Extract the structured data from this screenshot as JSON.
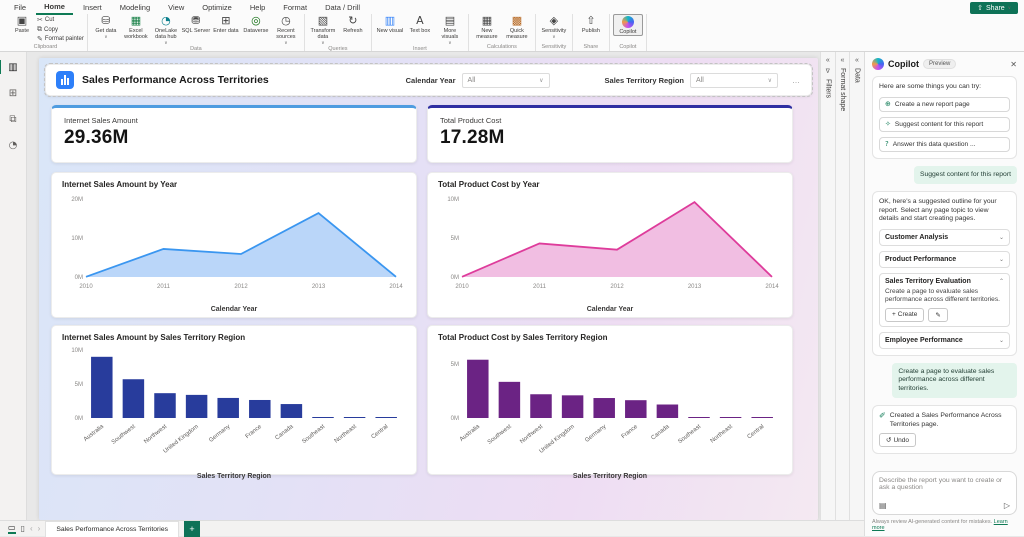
{
  "app": {
    "menu_tabs": [
      "File",
      "Home",
      "Insert",
      "Modeling",
      "View",
      "Optimize",
      "Help",
      "Format",
      "Data / Drill"
    ],
    "active_tab": "Home",
    "share_label": "Share",
    "ribbon_groups": [
      {
        "label": "Clipboard",
        "blocks": [
          {
            "big": {
              "label": "Paste",
              "icon": "paste-icon",
              "glyph": "▣"
            }
          },
          {
            "stack": [
              {
                "label": "Cut",
                "icon": "cut-icon",
                "glyph": "✂"
              },
              {
                "label": "Copy",
                "icon": "copy-icon",
                "glyph": "⧉"
              },
              {
                "label": "Format painter",
                "icon": "format-painter-icon",
                "glyph": "✎"
              }
            ]
          }
        ]
      },
      {
        "label": "Data",
        "blocks": [
          {
            "big": {
              "label": "Get data",
              "icon": "get-data-icon",
              "glyph": "⛁",
              "caret": true
            }
          },
          {
            "big": {
              "label": "Excel workbook",
              "icon": "excel-workbook-icon",
              "glyph": "▦",
              "color": "#107c41"
            }
          },
          {
            "big": {
              "label": "OneLake data hub",
              "icon": "onelake-data-hub-icon",
              "glyph": "◔",
              "caret": true,
              "color": "#0a7f8c"
            }
          },
          {
            "big": {
              "label": "SQL Server",
              "icon": "sql-server-icon",
              "glyph": "⛃"
            }
          },
          {
            "big": {
              "label": "Enter data",
              "icon": "enter-data-icon",
              "glyph": "⊞"
            }
          },
          {
            "big": {
              "label": "Dataverse",
              "icon": "dataverse-icon",
              "glyph": "◎",
              "color": "#0b6a0b"
            }
          },
          {
            "big": {
              "label": "Recent sources",
              "icon": "recent-sources-icon",
              "glyph": "◷",
              "caret": true
            }
          }
        ]
      },
      {
        "label": "Queries",
        "blocks": [
          {
            "big": {
              "label": "Transform data",
              "icon": "transform-data-icon",
              "glyph": "▧",
              "caret": true
            }
          },
          {
            "big": {
              "label": "Refresh",
              "icon": "refresh-icon",
              "glyph": "↻"
            }
          }
        ]
      },
      {
        "label": "Insert",
        "blocks": [
          {
            "big": {
              "label": "New visual",
              "icon": "new-visual-icon",
              "glyph": "▥",
              "color": "#2d7ff9"
            }
          },
          {
            "big": {
              "label": "Text box",
              "icon": "text-box-icon",
              "glyph": "A"
            }
          },
          {
            "big": {
              "label": "More visuals",
              "icon": "more-visuals-icon",
              "glyph": "▤",
              "caret": true
            }
          }
        ]
      },
      {
        "label": "Calculations",
        "blocks": [
          {
            "big": {
              "label": "New measure",
              "icon": "new-measure-icon",
              "glyph": "▦"
            }
          },
          {
            "big": {
              "label": "Quick measure",
              "icon": "quick-measure-icon",
              "glyph": "▩",
              "color": "#b5651d"
            }
          }
        ]
      },
      {
        "label": "Sensitivity",
        "blocks": [
          {
            "big": {
              "label": "Sensitivity",
              "icon": "sensitivity-icon",
              "glyph": "◈",
              "caret": true
            }
          }
        ]
      },
      {
        "label": "Share",
        "blocks": [
          {
            "big": {
              "label": "Publish",
              "icon": "publish-icon",
              "glyph": "⇧"
            }
          }
        ]
      },
      {
        "label": "Copilot",
        "blocks": [
          {
            "big": {
              "label": "Copilot",
              "icon": "copilot-icon",
              "glyph": "",
              "selected": true,
              "orb": true
            }
          }
        ]
      }
    ]
  },
  "left_rail": [
    {
      "icon": "report-view-icon",
      "glyph": "▥",
      "active": true
    },
    {
      "icon": "table-view-icon",
      "glyph": "⊞",
      "active": false
    },
    {
      "icon": "model-view-icon",
      "glyph": "⧉",
      "active": false
    },
    {
      "icon": "dax-query-view-icon",
      "glyph": "◔",
      "active": false
    }
  ],
  "report": {
    "title": "Sales Performance Across Territories",
    "more_options": "…",
    "slicers": [
      {
        "label": "Calendar Year",
        "value": "All"
      },
      {
        "label": "Sales Territory Region",
        "value": "All"
      }
    ],
    "cards": [
      {
        "title": "Internet Sales Amount",
        "value": "29.36M",
        "accent": "#4e9ce0"
      },
      {
        "title": "Total Product Cost",
        "value": "17.28M",
        "accent": "#2f2fa2"
      }
    ]
  },
  "chart_data": [
    {
      "type": "area",
      "title": "Internet Sales Amount by Year",
      "xlabel": "Calendar Year",
      "x": [
        "2010",
        "2011",
        "2012",
        "2013",
        "2014"
      ],
      "values": [
        0.05,
        7.2,
        5.9,
        16.4,
        0.04
      ],
      "ymax": 20,
      "yticks": [
        {
          "v": 0,
          "label": "0M"
        },
        {
          "v": 10,
          "label": "10M"
        },
        {
          "v": 20,
          "label": "20M"
        }
      ],
      "line": "#3a96f0",
      "fill": "#aecff8"
    },
    {
      "type": "area",
      "title": "Total Product Cost by Year",
      "xlabel": "Calendar Year",
      "x": [
        "2010",
        "2011",
        "2012",
        "2013",
        "2014"
      ],
      "values": [
        0.03,
        4.3,
        3.5,
        9.6,
        0.02
      ],
      "ymax": 10,
      "yticks": [
        {
          "v": 0,
          "label": "0M"
        },
        {
          "v": 5,
          "label": "5M"
        },
        {
          "v": 10,
          "label": "10M"
        }
      ],
      "line": "#de3c9b",
      "fill": "#efb3dd"
    },
    {
      "type": "bar",
      "title": "Internet Sales Amount by Sales Territory Region",
      "xlabel": "Sales Territory Region",
      "categories": [
        "Australia",
        "Southwest",
        "Northwest",
        "United Kingdom",
        "Germany",
        "France",
        "Canada",
        "Southeast",
        "Northeast",
        "Central"
      ],
      "values": [
        9.0,
        5.7,
        3.65,
        3.4,
        2.95,
        2.65,
        2.05,
        0.1,
        0.1,
        0.08
      ],
      "ymax": 10,
      "yticks": [
        {
          "v": 0,
          "label": "0M"
        },
        {
          "v": 5,
          "label": "5M"
        },
        {
          "v": 10,
          "label": "10M"
        }
      ],
      "bar": "#283c9c"
    },
    {
      "type": "bar",
      "title": "Total Product Cost by Sales Territory Region",
      "xlabel": "Sales Territory Region",
      "categories": [
        "Australia",
        "Southwest",
        "Northwest",
        "United Kingdom",
        "Germany",
        "France",
        "Canada",
        "Southeast",
        "Northeast",
        "Central"
      ],
      "values": [
        5.4,
        3.35,
        2.2,
        2.1,
        1.85,
        1.65,
        1.25,
        0.06,
        0.06,
        0.05
      ],
      "ymax": 6.3,
      "yticks": [
        {
          "v": 0,
          "label": "0M"
        },
        {
          "v": 5,
          "label": "5M"
        }
      ],
      "bar": "#6b2384"
    }
  ],
  "side_panels": [
    {
      "label": "Filters",
      "collapse_glyph": "«",
      "icon": "filter-icon",
      "glyph": "∇"
    },
    {
      "label": "Format shape",
      "collapse_glyph": "«",
      "icon": "format-shape-icon",
      "glyph": ""
    },
    {
      "label": "Data",
      "collapse_glyph": "«",
      "icon": "data-fields-icon",
      "glyph": ""
    }
  ],
  "copilot": {
    "title": "Copilot",
    "badge": "Preview",
    "close_glyph": "✕",
    "intro": "Here are some things you can try:",
    "suggestions": [
      {
        "icon": "new-report-page-icon",
        "glyph": "⊕",
        "label": "Create a new report page"
      },
      {
        "icon": "lightbulb-icon",
        "glyph": "✧",
        "label": "Suggest content for this report"
      },
      {
        "icon": "question-icon",
        "glyph": "?",
        "label": "Answer this data question ..."
      }
    ],
    "user_message_1": "Suggest content for this report",
    "outline_intro": "OK, here's a suggested outline for your report. Select any page topic to view details and start creating pages.",
    "outline_items": [
      {
        "label": "Customer Analysis",
        "expanded": false
      },
      {
        "label": "Product Performance",
        "expanded": false
      },
      {
        "label": "Sales Territory Evaluation",
        "expanded": true,
        "description": "Create a page to evaluate sales performance across different territories.",
        "create_label": "Create",
        "create_glyph": "+",
        "edit_icon": "edit-pencil-icon",
        "edit_glyph": "✎"
      },
      {
        "label": "Employee Performance",
        "expanded": false
      }
    ],
    "user_message_2": "Create a page to evaluate sales performance across different territories.",
    "created_icon": "magic-wand-icon",
    "created_glyph": "✐",
    "created_message": "Created a Sales Performance Across Territories page.",
    "undo_label": "Undo",
    "undo_glyph": "↺",
    "input_placeholder": "Describe the report you want to create or ask a question",
    "prompt_guide_glyph": "▤",
    "send_glyph": "▷",
    "footer": "Always review AI-generated content for mistakes.",
    "footer_link": "Learn more"
  },
  "bottom_bar": {
    "desktop_glyph": "▭",
    "phone_glyph": "▯",
    "prev_glyph": "‹",
    "next_glyph": "›",
    "page_tab": "Sales Performance Across Territories",
    "add_glyph": "+"
  }
}
